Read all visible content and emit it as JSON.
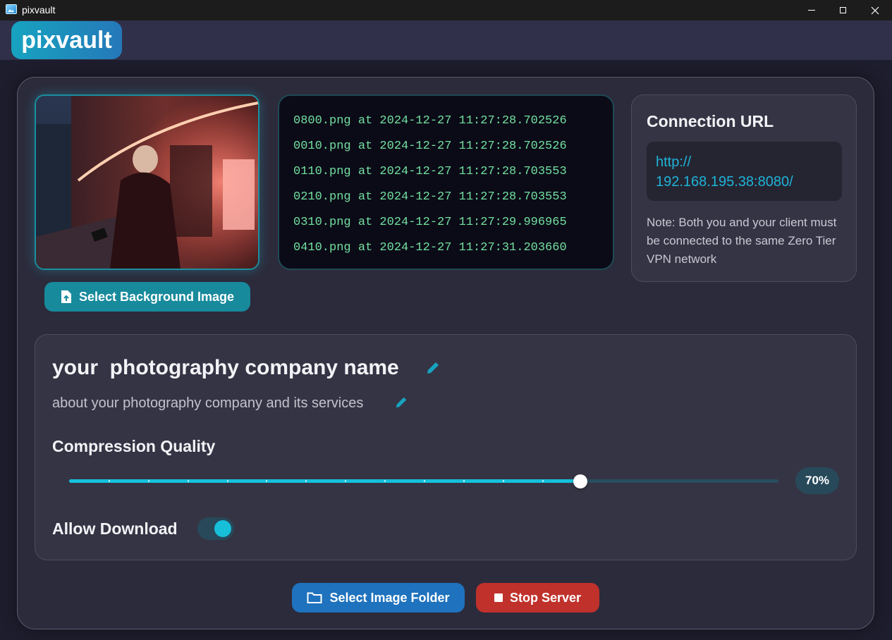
{
  "window": {
    "title": "pixvault",
    "controls": [
      "minimize-icon",
      "maximize-icon",
      "close-icon"
    ]
  },
  "header": {
    "logo": "pixvault"
  },
  "preview": {
    "description_icon": "photo-preview",
    "select_bg_label": "Select Background Image",
    "select_bg_icon": "file-upload-icon"
  },
  "log": {
    "lines": [
      "0800.png at 2024-12-27 11:27:28.702526",
      "0010.png at 2024-12-27 11:27:28.702526",
      "0110.png at 2024-12-27 11:27:28.703553",
      "0210.png at 2024-12-27 11:27:28.703553",
      "0310.png at 2024-12-27 11:27:29.996965",
      "0410.png at 2024-12-27 11:27:31.203660"
    ]
  },
  "connection": {
    "title": "Connection URL",
    "url_line1": "http://",
    "url_line2": "192.168.195.38:8080/",
    "note": "Note: Both you and your client must be connected to the same Zero Tier VPN network"
  },
  "settings": {
    "company_name": "your  photography company name",
    "about": "about your photography company and its services",
    "compression_label": "Compression Quality",
    "compression_value": 70,
    "compression_display": "70%",
    "allow_download_label": "Allow Download",
    "allow_download": true
  },
  "actions": {
    "select_folder_label": "Select Image Folder",
    "select_folder_icon": "folder-icon",
    "stop_label": "Stop Server",
    "stop_icon": "stop-icon"
  },
  "colors": {
    "accent": "#17bfd8",
    "folder_button": "#1f72bd",
    "stop_button": "#c0312c",
    "log_text": "#73e0a0",
    "url_text": "#1fb3d8"
  }
}
